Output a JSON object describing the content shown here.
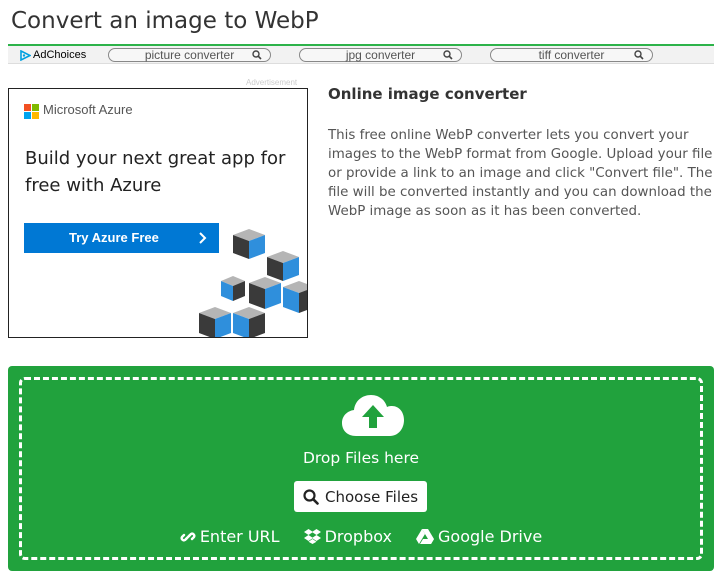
{
  "page": {
    "title": "Convert an image to WebP"
  },
  "adbar": {
    "adchoices": "AdChoices",
    "pills": [
      "picture converter",
      "jpg converter",
      "tiff converter"
    ]
  },
  "ad": {
    "label": "Advertisement",
    "brand": "Microsoft Azure",
    "headline": "Build your next great app for free with Azure",
    "cta": "Try Azure Free"
  },
  "info": {
    "title": "Online image converter",
    "text": "This free online WebP converter lets you convert your images to the WebP format from Google. Upload your file or provide a link to an image and click \"Convert file\". The file will be converted instantly and you can download the WebP image as soon as it has been converted."
  },
  "upload": {
    "drop_text": "Drop Files here",
    "choose": "Choose Files",
    "links": {
      "url": "Enter URL",
      "dropbox": "Dropbox",
      "gdrive": "Google Drive"
    }
  },
  "colors": {
    "accent": "#21a23d",
    "azure_blue": "#0078d4",
    "ms_red": "#f25022",
    "ms_green": "#7fba00",
    "ms_blue": "#00a4ef",
    "ms_yellow": "#ffb900"
  },
  "icons": [
    "adchoices-icon",
    "search-icon",
    "chevron-right-icon",
    "cloud-upload-icon",
    "link-icon",
    "dropbox-icon",
    "google-drive-icon"
  ]
}
